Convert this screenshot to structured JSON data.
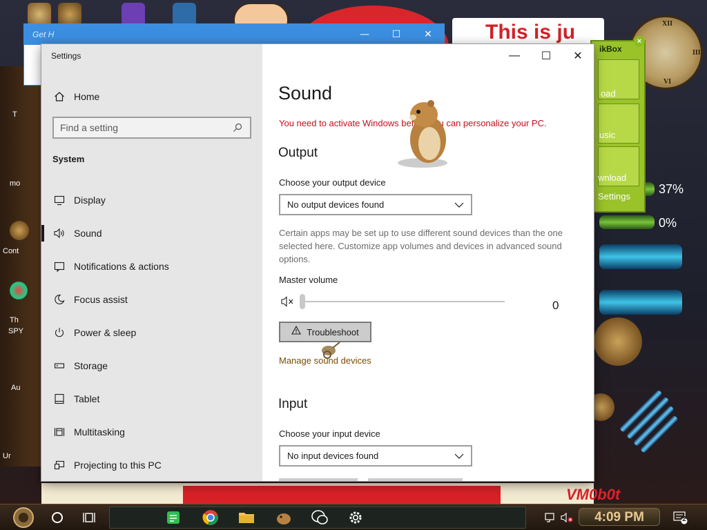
{
  "window": {
    "app_title": "Settings",
    "controls": {
      "minimize": "—",
      "maximize": "☐",
      "close": "✕"
    }
  },
  "background_window": {
    "title": "Get H",
    "controls": {
      "minimize": "—",
      "maximize": "☐",
      "close": "✕"
    }
  },
  "sidebar": {
    "home_label": "Home",
    "search_placeholder": "Find a setting",
    "section_label": "System",
    "items": [
      {
        "label": "Display",
        "icon": "display-icon"
      },
      {
        "label": "Sound",
        "icon": "speaker-icon",
        "selected": true
      },
      {
        "label": "Notifications & actions",
        "icon": "notifications-icon"
      },
      {
        "label": "Focus assist",
        "icon": "moon-icon"
      },
      {
        "label": "Power & sleep",
        "icon": "power-icon"
      },
      {
        "label": "Storage",
        "icon": "storage-icon"
      },
      {
        "label": "Tablet",
        "icon": "tablet-icon"
      },
      {
        "label": "Multitasking",
        "icon": "multitasking-icon"
      },
      {
        "label": "Projecting to this PC",
        "icon": "projecting-icon"
      }
    ]
  },
  "content": {
    "page_title": "Sound",
    "activation_notice": "You need to activate Windows before you can personalize your PC.",
    "output": {
      "heading": "Output",
      "device_label": "Choose your output device",
      "device_value": "No output devices found",
      "help_text": "Certain apps may be set up to use different sound devices than the one selected here. Customize app volumes and devices in advanced sound options.",
      "master_volume_label": "Master volume",
      "volume_value": "0",
      "troubleshoot_label": "Troubleshoot",
      "manage_link": "Manage sound devices"
    },
    "input": {
      "heading": "Input",
      "device_label": "Choose your input device",
      "device_value": "No input devices found"
    }
  },
  "desktop": {
    "banner_text": "This is ju",
    "gadget_title": "ikBox",
    "gadget_items": [
      "oad",
      "usic",
      "wnload"
    ],
    "gadget_settings": "Settings",
    "cpu_percent": "37%",
    "mem_percent": "0%",
    "watermark": "VM0b0t",
    "left_labels": [
      "T",
      "mo",
      "Cont",
      "Th",
      "SPY",
      "Au",
      "Ur"
    ]
  },
  "taskbar": {
    "time": "4:09 PM",
    "notification_count": "2"
  },
  "colors": {
    "accent_link": "#7a4c00",
    "activation_red": "#c50f1f",
    "sidebar_bg": "#e6e6e6",
    "taskbar_bg": "#2a1e15"
  }
}
